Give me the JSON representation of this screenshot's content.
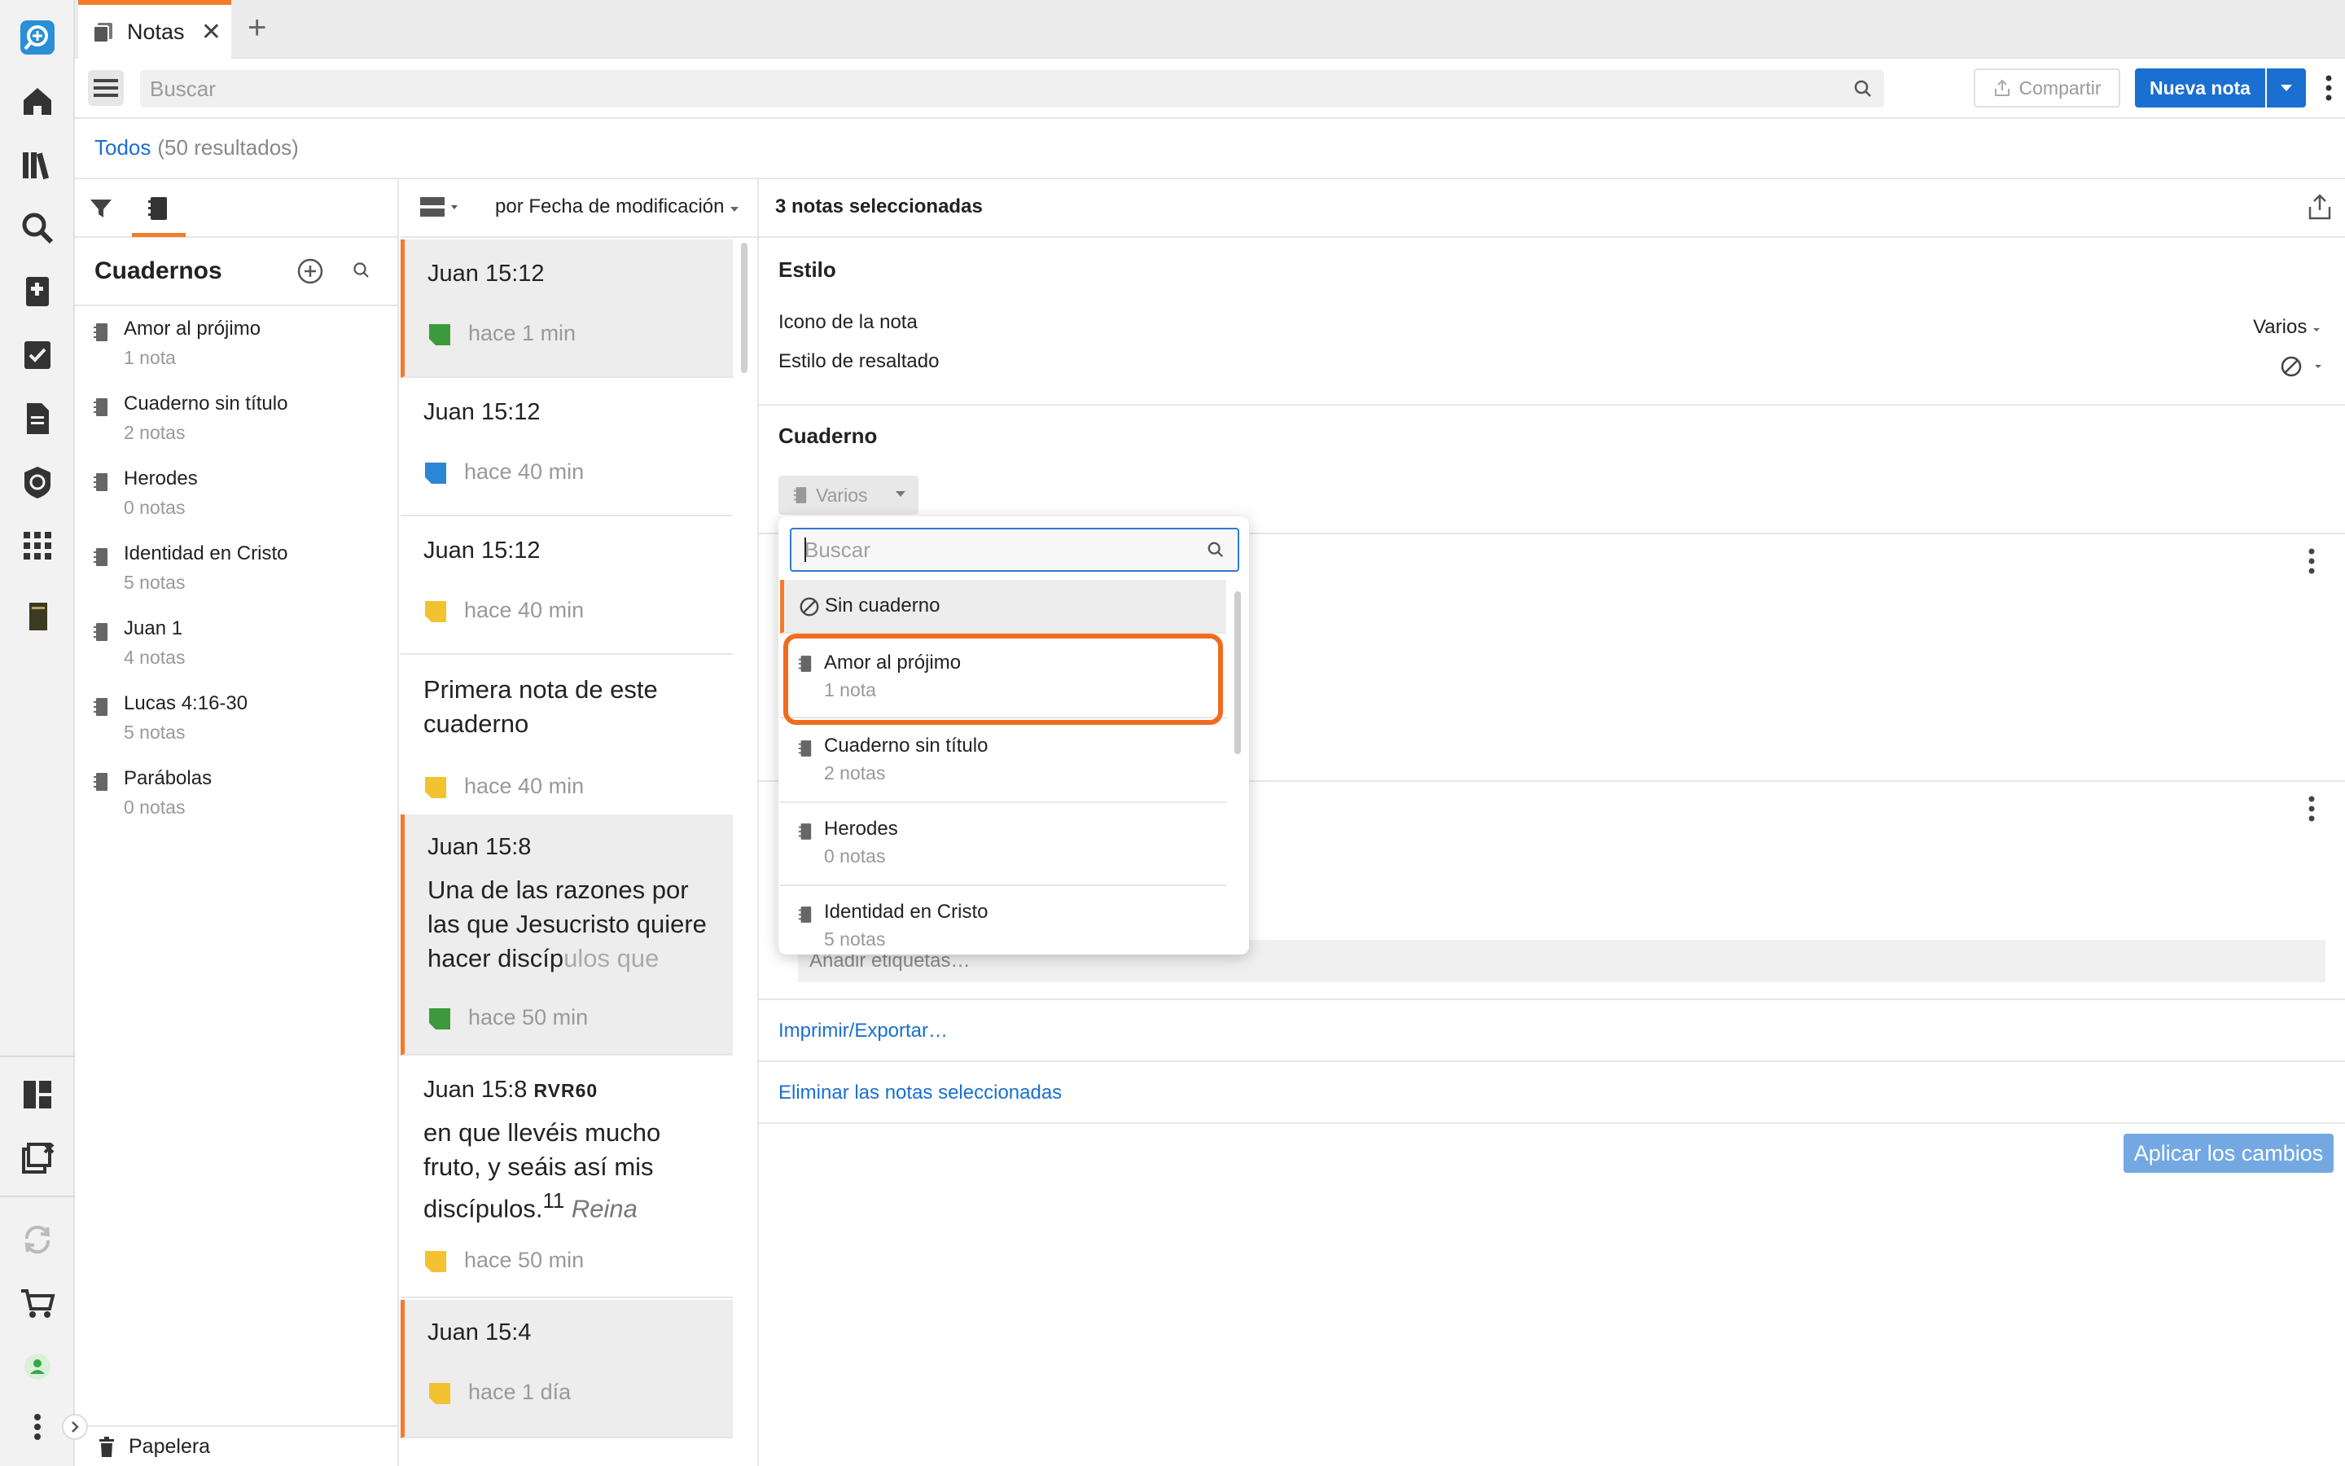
{
  "tab": {
    "title": "Notas"
  },
  "toolbar": {
    "search_placeholder": "Buscar",
    "share_label": "Compartir",
    "new_note_label": "Nueva nota"
  },
  "breadcrumb": {
    "all": "Todos",
    "count": "(50 resultados)"
  },
  "notebooks": {
    "title": "Cuadernos",
    "items": [
      {
        "name": "Amor al prójimo",
        "count": "1 nota"
      },
      {
        "name": "Cuaderno sin título",
        "count": "2 notas"
      },
      {
        "name": "Herodes",
        "count": "0 notas"
      },
      {
        "name": "Identidad en Cristo",
        "count": "5 notas"
      },
      {
        "name": "Juan 1",
        "count": "4 notas"
      },
      {
        "name": "Lucas 4:16-30",
        "count": "5 notas"
      },
      {
        "name": "Parábolas",
        "count": "0 notas"
      }
    ],
    "trash": "Papelera"
  },
  "notes": {
    "sort_label": "por Fecha de modificación",
    "items": [
      {
        "ref": "Juan 15:12",
        "when": "hace 1 min",
        "flag": "#3c9a3c"
      },
      {
        "ref": "Juan 15:12",
        "when": "hace 40 min",
        "flag": "#2b86d6"
      },
      {
        "ref": "Juan 15:12",
        "when": "hace 40 min",
        "flag": "#f2c230"
      },
      {
        "text": "Primera nota de este cuaderno",
        "when": "hace 40 min",
        "flag": "#f2c230"
      },
      {
        "ref": "Juan 15:8",
        "text_main": "Una de las razones por las que Jesucristo quiere hacer discíp",
        "text_fade": "ulos que",
        "when": "hace 50 min",
        "flag": "#3c9a3c"
      },
      {
        "ref": "Juan 15:8",
        "ref_version": "RVR60",
        "text_main": "en que llevéis mucho fruto, y seáis así mis discípulos.",
        "text_sup": "11",
        "text_em": "Reina",
        "when": "hace 50 min",
        "flag": "#f2c230"
      },
      {
        "ref": "Juan 15:4",
        "when": "hace 1 día",
        "flag": "#f2c230"
      }
    ]
  },
  "detail": {
    "selected_label": "3 notas seleccionadas",
    "style_title": "Estilo",
    "note_icon_label": "Icono de la nota",
    "note_icon_value": "Varios",
    "highlight_label": "Estilo de resaltado",
    "notebook_title": "Cuaderno",
    "notebook_value": "Varios",
    "tags_placeholder": "Añadir etiquetas…",
    "print_link": "Imprimir/Exportar…",
    "delete_link": "Eliminar las notas seleccionadas",
    "apply_label": "Aplicar los cambios"
  },
  "popup": {
    "search_placeholder": "Buscar",
    "none_label": "Sin cuaderno",
    "options": [
      {
        "name": "Amor al prójimo",
        "count": "1 nota"
      },
      {
        "name": "Cuaderno sin título",
        "count": "2 notas"
      },
      {
        "name": "Herodes",
        "count": "0 notas"
      },
      {
        "name": "Identidad en Cristo",
        "count": "5 notas"
      }
    ]
  },
  "colors": {
    "accent": "#f47b2a",
    "primary": "#1a6fd1",
    "annotation": "#f06b1f"
  }
}
